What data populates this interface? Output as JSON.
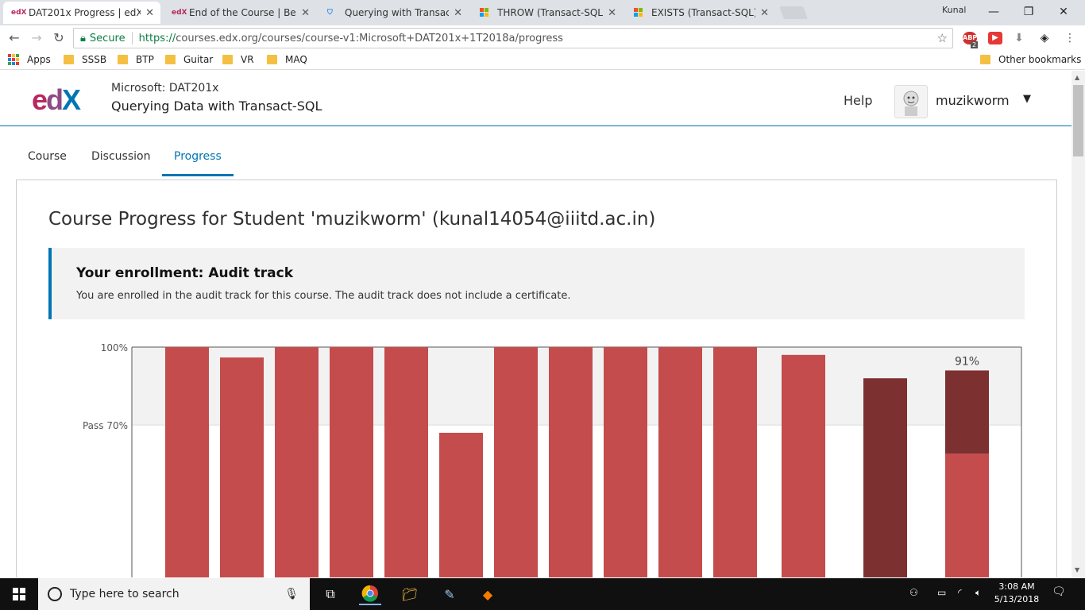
{
  "browser": {
    "tabs": [
      {
        "favicon": "edx",
        "title": "DAT201x Progress | edX",
        "active": true
      },
      {
        "favicon": "edx",
        "title": "End of the Course | Befor",
        "active": false
      },
      {
        "favicon": "shield",
        "title": "Querying with Transact-S",
        "active": false
      },
      {
        "favicon": "microsoft",
        "title": "THROW (Transact-SQL) | M",
        "active": false
      },
      {
        "favicon": "microsoft",
        "title": "EXISTS (Transact-SQL) | M",
        "active": false
      }
    ],
    "profile_name": "Kunal",
    "secure_label": "Secure",
    "url_scheme": "https://",
    "url_rest": "courses.edx.org/courses/course-v1:Microsoft+DAT201x+1T2018a/progress",
    "extension_badge": "2",
    "bookmarks": [
      "Apps",
      "SSSB",
      "BTP",
      "Guitar",
      "VR",
      "MAQ"
    ],
    "other_bookmarks": "Other bookmarks"
  },
  "header": {
    "course_org": "Microsoft: DAT201x",
    "course_name": "Querying Data with Transact-SQL",
    "help_label": "Help",
    "username": "muzikworm"
  },
  "course_tabs": [
    "Course",
    "Discussion",
    "Progress"
  ],
  "progress": {
    "title": "Course Progress for Student 'muzikworm' (kunal14054@iiitd.ac.in)",
    "enrollment_heading": "Your enrollment: Audit track",
    "enrollment_text": "You are enrolled in the audit track for this course. The audit track does not include a certificate."
  },
  "chart_data": {
    "type": "bar",
    "title": "",
    "xlabel": "",
    "ylabel": "",
    "ylim": [
      0,
      100
    ],
    "y_tick_labels": [
      {
        "value": 100,
        "label": "100%"
      },
      {
        "value": 70,
        "label": "Pass 70%"
      }
    ],
    "pass_threshold": 70,
    "series": [
      {
        "name": "",
        "values": [
          100,
          96,
          100,
          100,
          100,
          67,
          100,
          100,
          100,
          100,
          100,
          97,
          88,
          91
        ]
      }
    ],
    "dark_bars": [
      12
    ],
    "stacked_last": {
      "index": 13,
      "total": 91,
      "lower": 59
    },
    "total_label": "91%",
    "colors": {
      "bar": "#c44c4c",
      "dark_bar": "#7d3030",
      "pass_band": "#f2f2f2",
      "axis": "#555555"
    }
  },
  "taskbar": {
    "search_placeholder": "Type here to search",
    "time": "3:08 AM",
    "date": "5/13/2018"
  }
}
